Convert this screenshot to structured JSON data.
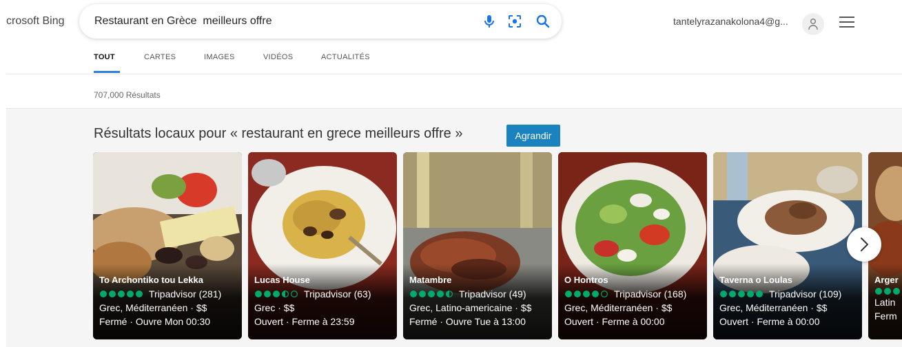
{
  "header": {
    "brand": "crosoft Bing",
    "search": {
      "query": "Restaurant en Grèce  meilleurs offre"
    },
    "account": "tantelyrazanakolona4@g..."
  },
  "tabs": [
    {
      "label": "TOUT",
      "active": true
    },
    {
      "label": "CARTES"
    },
    {
      "label": "IMAGES"
    },
    {
      "label": "VIDÉOS"
    },
    {
      "label": "ACTUALITÉS"
    }
  ],
  "results_count": "707,000 Résultats",
  "local": {
    "title": "Résultats locaux pour « restaurant en grece meilleurs offre »",
    "expand_label": "Agrandir",
    "rating_color": "#00aa6c",
    "cards": [
      {
        "name": "To Archontiko tou Lekka",
        "rating": 5,
        "reviews": "Tripadvisor (281)",
        "cuisine": "Grec, Méditerranéen · $$",
        "hours": "Fermé · Ouvre Mon 00:30"
      },
      {
        "name": "Lucas House",
        "rating": 3.5,
        "reviews": "Tripadvisor (63)",
        "cuisine": "Grec · $$",
        "hours": "Ouvert · Ferme à 23:59"
      },
      {
        "name": "Matambre",
        "rating": 4.5,
        "reviews": "Tripadvisor (49)",
        "cuisine": "Grec, Latino-americaine · $$",
        "hours": "Fermé · Ouvre Tue à 13:00"
      },
      {
        "name": "O Hontros",
        "rating": 4,
        "reviews": "Tripadvisor (168)",
        "cuisine": "Grec, Méditerranéen · $$",
        "hours": "Ouvert · Ferme à 00:00"
      },
      {
        "name": "Taverna o Loulas",
        "rating": 5,
        "reviews": "Tripadvisor (109)",
        "cuisine": "Grec, Méditerranéen · $$",
        "hours": "Ouvert · Ferme à 00:00"
      },
      {
        "name": "Arger",
        "rating": 5,
        "reviews": "",
        "cuisine": "Latin",
        "hours": "Ferm"
      }
    ]
  }
}
